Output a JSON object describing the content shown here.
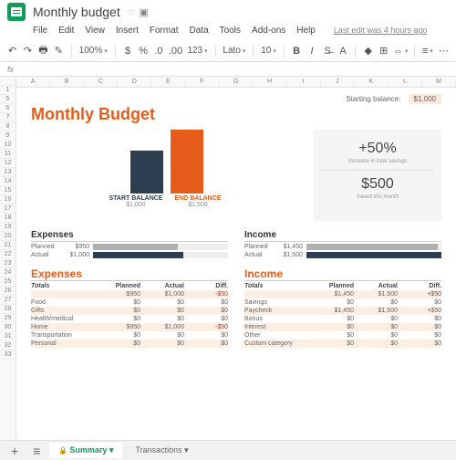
{
  "doc": {
    "title": "Monthly budget"
  },
  "menu": {
    "file": "File",
    "edit": "Edit",
    "view": "View",
    "insert": "Insert",
    "format": "Format",
    "data": "Data",
    "tools": "Tools",
    "addons": "Add-ons",
    "help": "Help",
    "last_edit": "Last edit was 4 hours ago"
  },
  "toolbar": {
    "zoom": "100%",
    "font": "Lato",
    "size": "10",
    "fmt": "123"
  },
  "cols": [
    "A",
    "B",
    "C",
    "D",
    "E",
    "F",
    "G",
    "H",
    "I",
    "J",
    "K",
    "L",
    "M"
  ],
  "rows": [
    "1",
    "5",
    "6",
    "7",
    "8",
    "9",
    "10",
    "11",
    "12",
    "13",
    "14",
    "15",
    "16",
    "17",
    "18",
    "19",
    "20",
    "21",
    "22",
    "23",
    "24",
    "25",
    "26",
    "27",
    "28",
    "29",
    "30",
    "31",
    "32",
    "33"
  ],
  "starting": {
    "label": "Starting balance:",
    "value": "$1,000"
  },
  "title": "Monthly Budget",
  "chart_data": {
    "type": "bar",
    "categories": [
      "START BALANCE",
      "END BALANCE"
    ],
    "values": [
      1000,
      1500
    ],
    "display_values": [
      "$1,000",
      "$1,500"
    ],
    "colors": [
      "#2c3e50",
      "#e65c1a"
    ],
    "ylim": [
      0,
      1500
    ]
  },
  "stats": {
    "pct": "+50%",
    "pct_sub": "Increase in total savings",
    "saved": "$500",
    "saved_sub": "Saved this month"
  },
  "exp_sum": {
    "title": "Expenses",
    "planned_lbl": "Planned",
    "planned": "$950",
    "planned_pct": 63,
    "actual_lbl": "Actual",
    "actual": "$1,000",
    "actual_pct": 67
  },
  "inc_sum": {
    "title": "Income",
    "planned_lbl": "Planned",
    "planned": "$1,450",
    "planned_pct": 97,
    "actual_lbl": "Actual",
    "actual": "$1,500",
    "actual_pct": 100
  },
  "exp_tbl": {
    "title": "Expenses",
    "totals_lbl": "Totals",
    "c_planned": "Planned",
    "c_actual": "Actual",
    "c_diff": "Diff.",
    "tot": {
      "p": "$950",
      "a": "$1,000",
      "d": "-$50"
    },
    "rows": [
      {
        "n": "Food",
        "p": "$0",
        "a": "$0",
        "d": "$0"
      },
      {
        "n": "Gifts",
        "p": "$0",
        "a": "$0",
        "d": "$0"
      },
      {
        "n": "Health/medical",
        "p": "$0",
        "a": "$0",
        "d": "$0"
      },
      {
        "n": "Home",
        "p": "$950",
        "a": "$1,000",
        "d": "-$50"
      },
      {
        "n": "Transportation",
        "p": "$0",
        "a": "$0",
        "d": "$0"
      },
      {
        "n": "Personal",
        "p": "$0",
        "a": "$0",
        "d": "$0"
      }
    ]
  },
  "inc_tbl": {
    "title": "Income",
    "totals_lbl": "Totals",
    "c_planned": "Planned",
    "c_actual": "Actual",
    "c_diff": "Diff.",
    "tot": {
      "p": "$1,450",
      "a": "$1,500",
      "d": "+$50"
    },
    "rows": [
      {
        "n": "Savings",
        "p": "$0",
        "a": "$0",
        "d": "$0"
      },
      {
        "n": "Paycheck",
        "p": "$1,450",
        "a": "$1,500",
        "d": "+$50"
      },
      {
        "n": "Bonus",
        "p": "$0",
        "a": "$0",
        "d": "$0"
      },
      {
        "n": "Interest",
        "p": "$0",
        "a": "$0",
        "d": "$0"
      },
      {
        "n": "Other",
        "p": "$0",
        "a": "$0",
        "d": "$0"
      },
      {
        "n": "Custom category",
        "p": "$0",
        "a": "$0",
        "d": "$0"
      }
    ]
  },
  "tabs": {
    "summary": "Summary",
    "transactions": "Transactions"
  }
}
